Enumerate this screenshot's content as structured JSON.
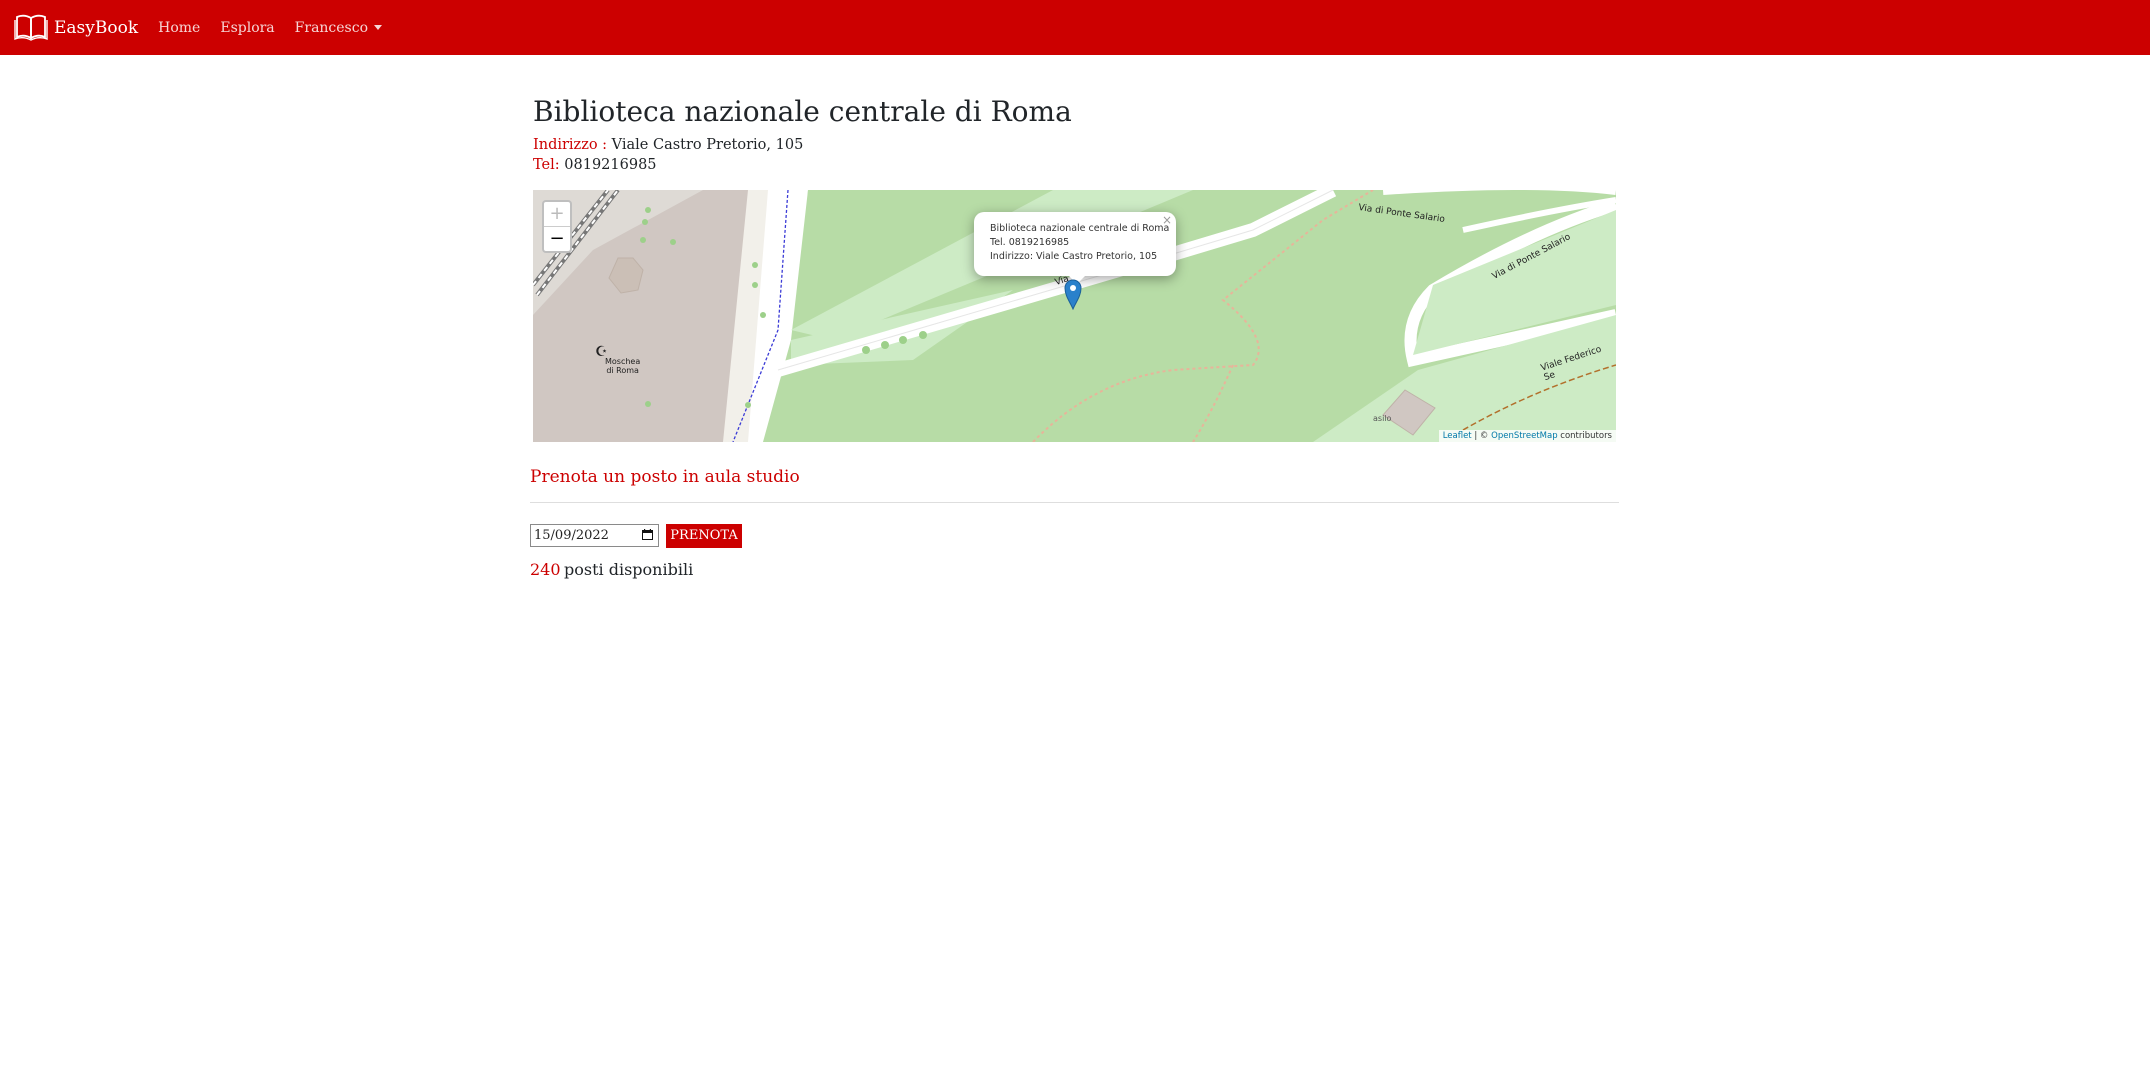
{
  "navbar": {
    "brand": "EasyBook",
    "brand_icon": "open-book-icon",
    "links": [
      "Home",
      "Esplora"
    ],
    "user_menu": "Francesco"
  },
  "library": {
    "name": "Biblioteca nazionale centrale di Roma",
    "address_label": "Indirizzo :",
    "address": "Viale Castro Pretorio, 105",
    "phone_label": "Tel:",
    "phone": "0819216985"
  },
  "map": {
    "zoom_in": "+",
    "zoom_out": "−",
    "popup": {
      "line1": "Biblioteca nazionale centrale di Roma",
      "line2": "Tel. 0819216985",
      "line3": "Indirizzo: Viale Castro Pretorio, 105",
      "close": "×"
    },
    "labels": {
      "mosque_line1": "Moschea",
      "mosque_line2": "di Roma",
      "via_ponte_salario_1": "Via di Ponte Salario",
      "via_ponte_salario_2": "Via di Ponte Salario",
      "viale_federico": "Viale Federico Se",
      "asilo": "asilo",
      "via_partial": "Via"
    },
    "attribution": {
      "leaflet": "Leaflet",
      "separator": "| ©",
      "osm": "OpenStreetMap",
      "suffix": "contributors"
    },
    "colors": {
      "park": "#b7dca6",
      "grass": "#cdebc5",
      "road": "#ffffff",
      "built": "#d0c7c2",
      "marker": "#2a81cb"
    }
  },
  "booking": {
    "section_title": "Prenota un posto in aula studio",
    "date_value": "15/09/2022",
    "button_label": "PRENOTA",
    "available_count": "240",
    "available_label": "posti disponibili"
  },
  "colors": {
    "brand_red": "#cc0000",
    "text": "#212529"
  }
}
